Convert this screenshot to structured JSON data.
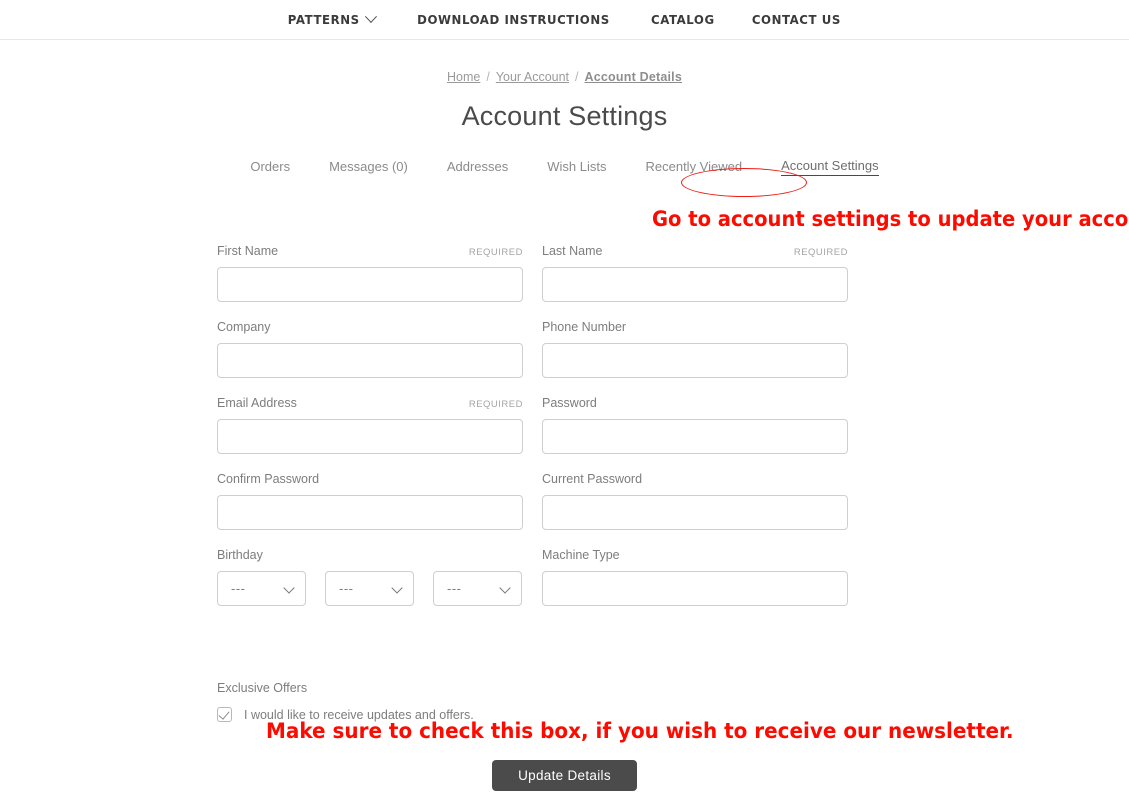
{
  "nav": {
    "items": [
      {
        "label": "Patterns",
        "has_dropdown": true
      },
      {
        "label": "Download Instructions",
        "has_dropdown": false
      },
      {
        "label": "Catalog",
        "has_dropdown": false
      },
      {
        "label": "Contact Us",
        "has_dropdown": false
      }
    ]
  },
  "breadcrumb": {
    "home": "Home",
    "sep1": "/",
    "account": "Your Account",
    "sep2": "/",
    "current": "Account Details"
  },
  "page": {
    "title": "Account Settings"
  },
  "tabs": [
    {
      "label": "Orders",
      "active": false
    },
    {
      "label": "Messages (0)",
      "active": false
    },
    {
      "label": "Addresses",
      "active": false
    },
    {
      "label": "Wish Lists",
      "active": false
    },
    {
      "label": "Recently Viewed",
      "active": false
    },
    {
      "label": "Account Settings",
      "active": true
    }
  ],
  "annotations": {
    "top": "Go to account settings to update your account.",
    "bottom": "Make sure to check this box, if you wish to receive our newsletter.",
    "color": "#fb0b00",
    "ellipse_color": "#ee1c14"
  },
  "form": {
    "required_label": "REQUIRED",
    "fields": {
      "first_name": {
        "label": "First Name",
        "required": true,
        "value": "",
        "placeholder": ""
      },
      "last_name": {
        "label": "Last Name",
        "required": true,
        "value": "",
        "placeholder": ""
      },
      "company": {
        "label": "Company",
        "required": false,
        "value": "",
        "placeholder": ""
      },
      "phone_number": {
        "label": "Phone Number",
        "required": false,
        "value": "",
        "placeholder": ""
      },
      "email_address": {
        "label": "Email Address",
        "required": true,
        "value": "",
        "placeholder": ""
      },
      "password": {
        "label": "Password",
        "required": false,
        "value": "",
        "placeholder": ""
      },
      "confirm_password": {
        "label": "Confirm Password",
        "required": false,
        "value": "",
        "placeholder": ""
      },
      "current_password": {
        "label": "Current Password",
        "required": false,
        "value": "",
        "placeholder": ""
      },
      "birthday": {
        "label": "Birthday",
        "required": false
      },
      "machine_type": {
        "label": "Machine Type",
        "required": false,
        "value": "",
        "placeholder": ""
      }
    },
    "birthday_selects": [
      {
        "name": "day",
        "value": "---"
      },
      {
        "name": "month",
        "value": "---"
      },
      {
        "name": "year",
        "value": "---"
      }
    ],
    "exclusive_offers": {
      "title": "Exclusive Offers",
      "checkbox_label": "I would like to receive updates and offers.",
      "checked": true
    },
    "submit_label": "Update Details"
  }
}
